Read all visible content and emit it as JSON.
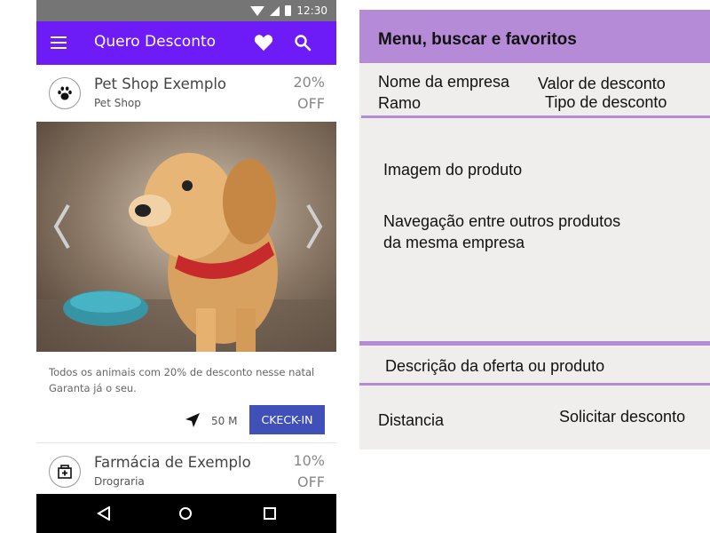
{
  "status_bar": {
    "time": "12:30"
  },
  "app_bar": {
    "title": "Quero Desconto"
  },
  "cards": [
    {
      "company_name": "Pet Shop Exemplo",
      "branch": "Pet Shop",
      "discount_value": "20%",
      "discount_type": "OFF",
      "icon": "paw-icon",
      "description_line1": "Todos os animais com 20% de desconto nesse natal",
      "description_line2": "Garanta já o seu.",
      "distance": "50 M",
      "checkin_label": "CKECK-IN"
    },
    {
      "company_name": "Farmácia de Exemplo",
      "branch": "Drograria",
      "discount_value": "10%",
      "discount_type": "OFF",
      "icon": "pharmacy-icon"
    }
  ],
  "annotations": {
    "header": "Menu, buscar e favoritos",
    "company_name": "Nome da empresa",
    "branch": "Ramo",
    "discount_value": "Valor de desconto",
    "discount_type": "Tipo de desconto",
    "product_image": "Imagem do produto",
    "navigation_line1": "Navegação entre outros produtos",
    "navigation_line2": "da mesma empresa",
    "description": "Descrição da oferta ou produto",
    "distance": "Distancia",
    "request_discount": "Solicitar desconto"
  },
  "colors": {
    "app_bar": "#6d1bf7",
    "checkin_button": "#4050b8",
    "annotation_accent": "#b58ad6",
    "annotation_bg": "#f0eeed"
  }
}
